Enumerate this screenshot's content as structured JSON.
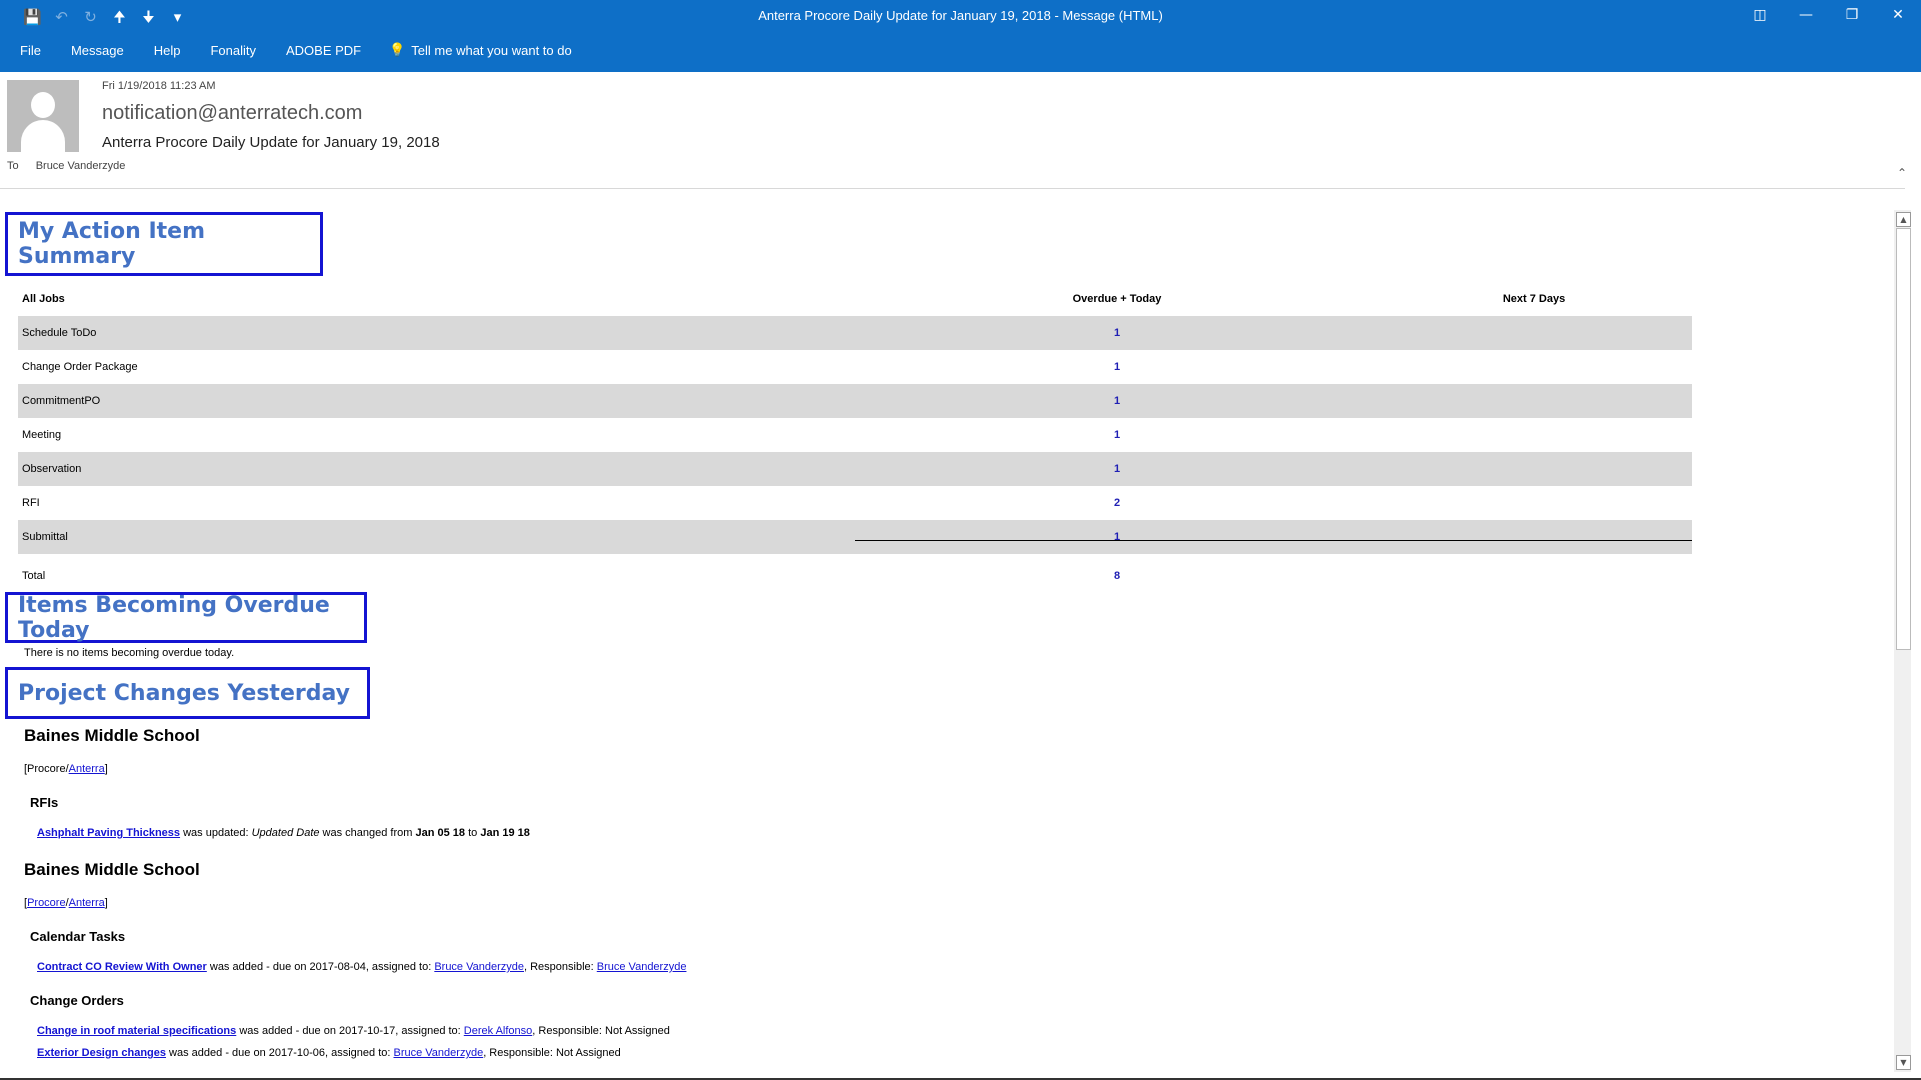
{
  "window": {
    "title": "Anterra Procore Daily Update for January 19, 2018  -  Message (HTML)"
  },
  "ribbon": {
    "tabs": [
      "File",
      "Message",
      "Help",
      "Fonality",
      "ADOBE PDF"
    ],
    "tell_me": "Tell me what you want to do"
  },
  "header": {
    "date": "Fri 1/19/2018 11:23 AM",
    "from": "notification@anterratech.com",
    "subject": "Anterra Procore Daily Update for January 19, 2018",
    "to_label": "To",
    "to": "Bruce Vanderzyde"
  },
  "summary": {
    "title": "My Action Item Summary",
    "columns": [
      "All Jobs",
      "Overdue + Today",
      "Next 7 Days"
    ],
    "rows": [
      {
        "label": "Schedule ToDo",
        "overdue": "1",
        "next7": ""
      },
      {
        "label": "Change Order Package",
        "overdue": "1",
        "next7": ""
      },
      {
        "label": "CommitmentPO",
        "overdue": "1",
        "next7": ""
      },
      {
        "label": "Meeting",
        "overdue": "1",
        "next7": ""
      },
      {
        "label": "Observation",
        "overdue": "1",
        "next7": ""
      },
      {
        "label": "RFI",
        "overdue": "2",
        "next7": ""
      },
      {
        "label": "Submittal",
        "overdue": "1",
        "next7": ""
      }
    ],
    "total_label": "Total",
    "total_overdue": "8"
  },
  "overdue": {
    "title": "Items Becoming Overdue Today",
    "text": "There is no items becoming overdue today."
  },
  "changes": {
    "title": "Project Changes Yesterday",
    "block1": {
      "project": "Baines Middle School",
      "links_open": "[Procore/",
      "link": "Anterra",
      "links_close": "]",
      "section": "RFIs",
      "item_link": "Ashphalt Paving Thickness",
      "item_text1": " was updated: ",
      "item_field": "Updated Date",
      "item_text2": " was changed from ",
      "item_from": "Jan 05 18",
      "item_to_word": " to ",
      "item_to": "Jan 19 18"
    },
    "block2": {
      "project": "Baines Middle School",
      "bracket_open": "[",
      "link1": "Procore",
      "slash": "/",
      "link2": "Anterra",
      "bracket_close": "]",
      "section1": "Calendar Tasks",
      "task_link": "Contract CO Review With Owner",
      "task_text": " was added - due on 2017-08-04, assigned to: ",
      "task_assignee": "Bruce Vanderzyde",
      "task_resp_label": ", Responsible: ",
      "task_resp": "Bruce Vanderzyde",
      "section2": "Change Orders",
      "co1_link": "Change in roof material specifications",
      "co1_text": " was added - due on 2017-10-17, assigned to: ",
      "co1_assignee": "Derek Alfonso",
      "co1_resp": ", Responsible: Not Assigned",
      "co2_link": "Exterior Design changes",
      "co2_text": " was added - due on 2017-10-06, assigned to: ",
      "co2_assignee": "Bruce Vanderzyde",
      "co2_resp": ", Responsible: Not Assigned"
    }
  }
}
